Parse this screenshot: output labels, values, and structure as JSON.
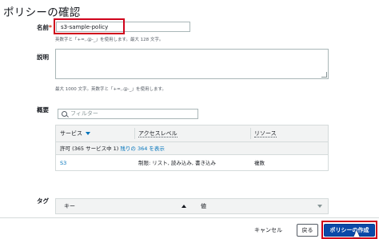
{
  "page": {
    "title": "ポリシーの確認"
  },
  "form": {
    "name_label": "名前",
    "required_mark": "*",
    "name_value": "s3-sample-policy",
    "name_hint": "英数字と「+=,.@-_」を使用します。最大 128 文字。",
    "description_label": "説明",
    "description_hint": "最大 1000 文字。英数字と「+=,.@-_」を使用します。",
    "summary_label": "概要",
    "tags_label": "タグ"
  },
  "summary": {
    "filter_placeholder": "フィルター",
    "columns": [
      "サービス",
      "アクセスレベル",
      "リソース"
    ],
    "allow_text": "許可 (365 サービス中 1)",
    "allow_link": "残りの 364 を表示",
    "rows": [
      {
        "service": "S3",
        "access": "制限: リスト, 読み込み, 書き込み",
        "resource": "複数"
      }
    ]
  },
  "tags": {
    "columns": [
      "キー",
      "値"
    ]
  },
  "footer": {
    "cancel_label": "キャンセル",
    "back_label": "戻る",
    "create_label": "ポリシーの作成"
  },
  "colors": {
    "highlight": "#d0021b",
    "link": "#0073bb",
    "primary_button": "#0a49a8"
  },
  "icons": [
    "search-icon",
    "sort-caret-icon",
    "resize-grip-icon",
    "cursor-icon"
  ]
}
